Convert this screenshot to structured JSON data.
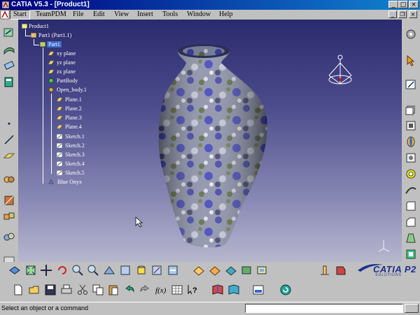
{
  "window": {
    "title": "CATIA V5.3 - [Product1]",
    "minimize": "_",
    "maximize": "□",
    "close": "×"
  },
  "menu": {
    "items": [
      {
        "label": "Start"
      },
      {
        "label": "TeamPDM"
      },
      {
        "label": "File"
      },
      {
        "label": "Edit"
      },
      {
        "label": "View"
      },
      {
        "label": "Insert"
      },
      {
        "label": "Tools"
      },
      {
        "label": "Window"
      },
      {
        "label": "Help"
      }
    ],
    "mdi_minimize": "_",
    "mdi_restore": "❐",
    "mdi_close": "×"
  },
  "tree": {
    "nodes": [
      {
        "label": "Product1",
        "icon": "product-icon"
      },
      {
        "label": "Part1 (Part1.1)",
        "icon": "part-instance-icon"
      },
      {
        "label": "Part1",
        "icon": "part-icon",
        "selected": true
      },
      {
        "label": "xy plane",
        "icon": "plane-icon"
      },
      {
        "label": "yz plane",
        "icon": "plane-icon"
      },
      {
        "label": "zx plane",
        "icon": "plane-icon"
      },
      {
        "label": "PartBody",
        "icon": "body-icon"
      },
      {
        "label": "Open_body.1",
        "icon": "open-body-icon"
      },
      {
        "label": "Plane.1",
        "icon": "plane-icon"
      },
      {
        "label": "Plane.2",
        "icon": "plane-icon"
      },
      {
        "label": "Plane.3",
        "icon": "plane-icon"
      },
      {
        "label": "Plane.4",
        "icon": "plane-icon"
      },
      {
        "label": "Sketch.1",
        "icon": "sketch-icon"
      },
      {
        "label": "Sketch.2",
        "icon": "sketch-icon"
      },
      {
        "label": "Sketch.3",
        "icon": "sketch-icon"
      },
      {
        "label": "Sketch.4",
        "icon": "sketch-icon"
      },
      {
        "label": "Sketch.5",
        "icon": "sketch-icon"
      },
      {
        "label": "Blue Onyx",
        "icon": "material-icon"
      }
    ]
  },
  "brand": {
    "logo": "CATIA P2",
    "sub": "SOLUTIONS"
  },
  "status": {
    "message": "Select an object or a command",
    "command_value": ""
  },
  "colors": {
    "titlebar": "#000080",
    "selection": "#3c6cc8",
    "material": "#6c7aa8"
  }
}
